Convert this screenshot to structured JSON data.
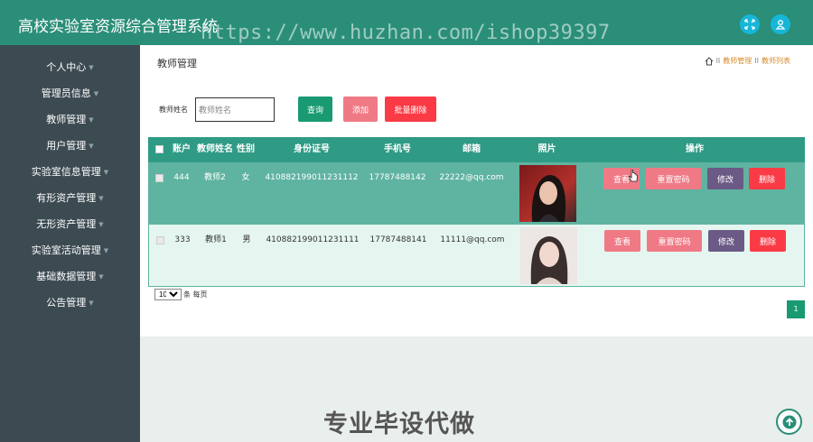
{
  "header": {
    "app_title": "高校实验室资源综合管理系统",
    "watermark": "https://www.huzhan.com/ishop39397",
    "icons": [
      "expand-icon",
      "user-icon"
    ],
    "accent_color": "#2a8e78",
    "icon_color": "#17b6d8"
  },
  "sidebar": {
    "background": "#3c4a52",
    "items": [
      {
        "label": "个人中心"
      },
      {
        "label": "管理员信息"
      },
      {
        "label": "教师管理"
      },
      {
        "label": "用户管理"
      },
      {
        "label": "实验室信息管理"
      },
      {
        "label": "有形资产管理"
      },
      {
        "label": "无形资产管理"
      },
      {
        "label": "实验室活动管理"
      },
      {
        "label": "基础数据管理"
      },
      {
        "label": "公告管理"
      }
    ]
  },
  "main": {
    "page_title": "教师管理",
    "breadcrumb": {
      "separator": "II",
      "items": [
        "教师管理",
        "教师列表"
      ]
    },
    "search": {
      "label": "教师姓名",
      "placeholder": "教师姓名"
    },
    "buttons": {
      "query": "查询",
      "add": "添加",
      "batch_delete": "批量删除"
    },
    "table": {
      "columns": [
        "账户",
        "教师姓名",
        "性别",
        "身份证号",
        "手机号",
        "邮箱",
        "照片",
        "操作"
      ],
      "rows": [
        {
          "account": "444",
          "name": "教师2",
          "gender": "女",
          "id_number": "410882199011231112",
          "phone": "17787488142",
          "email": "22222@qq.com"
        },
        {
          "account": "333",
          "name": "教师1",
          "gender": "男",
          "id_number": "410882199011231111",
          "phone": "17787488141",
          "email": "11111@qq.com"
        }
      ],
      "actions": {
        "view": "查看",
        "reset_password": "重置密码",
        "edit": "修改",
        "delete": "删除"
      }
    },
    "pagination": {
      "page_size": "10",
      "page_size_label": "条 每页",
      "current_page": "1"
    }
  },
  "overlay": {
    "text": "专业毕设代做"
  }
}
